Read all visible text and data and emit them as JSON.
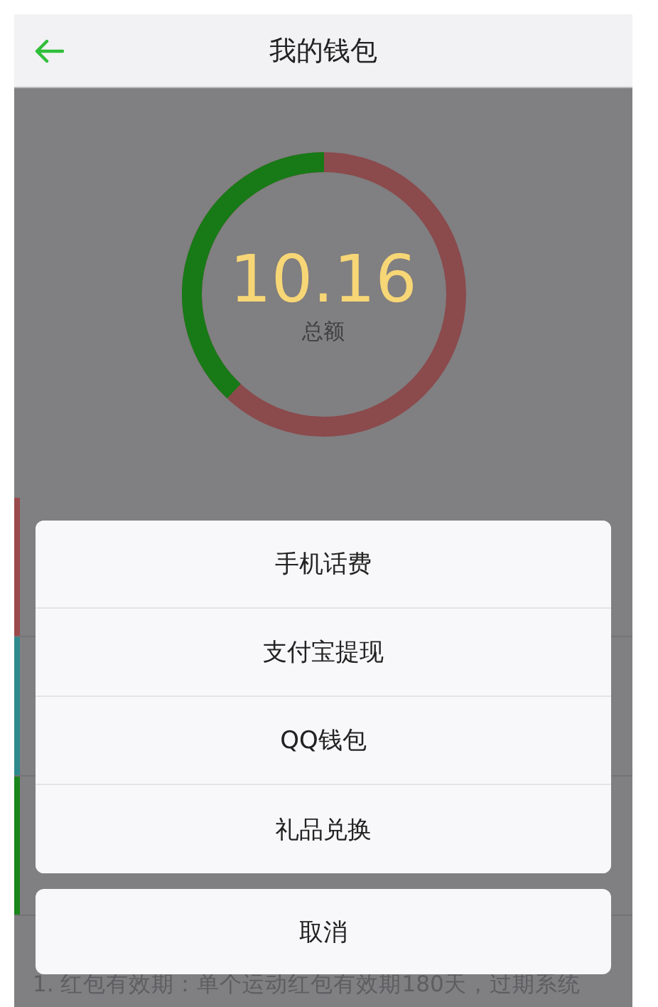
{
  "header": {
    "title": "我的钱包"
  },
  "summary": {
    "amount": "10.16",
    "label": "总额"
  },
  "background_rows": [
    {
      "color": "#9a4a4c"
    },
    {
      "color": "#2e8a8c"
    },
    {
      "color": "#1a861c"
    }
  ],
  "note": "1. 红包有效期：单个运动红包有效期180天，过期系统",
  "action_sheet": {
    "options": [
      "手机话费",
      "支付宝提现",
      "QQ钱包",
      "礼品兑换"
    ],
    "cancel": "取消"
  }
}
